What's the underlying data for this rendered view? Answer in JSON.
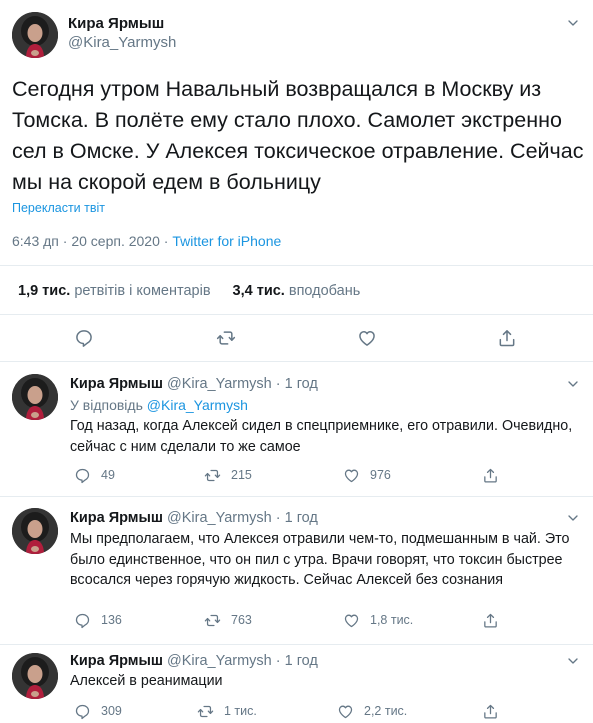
{
  "main_tweet": {
    "author_name": "Кира Ярмыш",
    "author_handle": "@Kira_Yarmysh",
    "text": "Сегодня утром Навальный возвращался в Москву из Томска. В полёте ему стало плохо. Самолет экстренно сел в Омске. У Алексея токсическое отравление. Сейчас мы на скорой едем в больницу",
    "translate_label": "Перекласти твіт",
    "timestamp": "6:43 дп · 20 серп. 2020",
    "separator": " · ",
    "source": "Twitter for iPhone",
    "retweets_count": "1,9 тис.",
    "retweets_label": "ретвітів і коментарів",
    "likes_count": "3,4 тис.",
    "likes_label": "вподобань"
  },
  "replies": [
    {
      "author_name": "Кира Ярмыш",
      "author_handle": "@Kira_Yarmysh",
      "time": "· 1 год",
      "reply_to_label": "У відповідь",
      "reply_to_handle": "@Kira_Yarmysh",
      "text": "Год назад, когда Алексей сидел в спецприемнике, его отравили. Очевидно, сейчас с ним сделали то же самое",
      "replies_count": "49",
      "retweets_count": "215",
      "likes_count": "976"
    },
    {
      "author_name": "Кира Ярмыш",
      "author_handle": "@Kira_Yarmysh",
      "time": "· 1 год",
      "text": "Мы предполагаем, что Алексея отравили чем-то, подмешанным в чай. Это было единственное, что он пил с утра. Врачи говорят, что токсин быстрее всосался через горячую жидкость. Сейчас Алексей без сознания",
      "replies_count": "136",
      "retweets_count": "763",
      "likes_count": "1,8 тис."
    },
    {
      "author_name": "Кира Ярмыш",
      "author_handle": "@Kira_Yarmysh",
      "time": "· 1 год",
      "text": "Алексей в реанимации",
      "replies_count": "309",
      "retweets_count": "1 тис.",
      "likes_count": "2,2 тис."
    }
  ],
  "icons": {
    "reply": "reply-icon",
    "retweet": "retweet-icon",
    "like": "heart-icon",
    "share": "share-icon",
    "more": "chevron-down-icon"
  },
  "colors": {
    "link": "#1b95e0",
    "secondary_text": "#657786",
    "primary_text": "#14171a",
    "divider": "#e6ecf0"
  }
}
